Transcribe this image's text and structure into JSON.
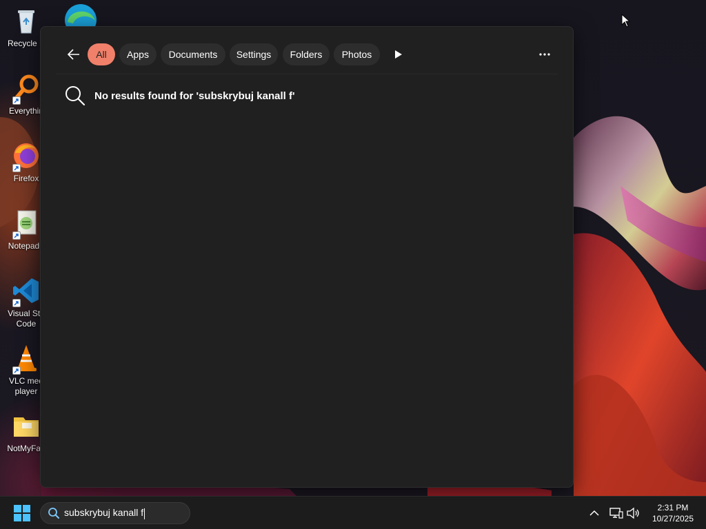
{
  "desktop": {
    "icons": [
      {
        "label": "Recycle B",
        "icon": "recycle-bin-icon"
      },
      {
        "label": "Everythin",
        "icon": "everything-search-icon"
      },
      {
        "label": "Firefox",
        "icon": "firefox-icon"
      },
      {
        "label": "Notepad+",
        "icon": "notepad-plus-plus-icon"
      },
      {
        "label": "Visual Stu Code",
        "line1": "Visual Stu",
        "line2": "Code",
        "icon": "vscode-icon"
      },
      {
        "label": "VLC med player",
        "line1": "VLC med",
        "line2": "player",
        "icon": "vlc-icon"
      },
      {
        "label": "NotMyFau",
        "icon": "folder-icon"
      }
    ],
    "partial_icon": "edge-icon"
  },
  "search_panel": {
    "back_icon": "back-arrow-icon",
    "filters": [
      {
        "label": "All",
        "active": true
      },
      {
        "label": "Apps",
        "active": false
      },
      {
        "label": "Documents",
        "active": false
      },
      {
        "label": "Settings",
        "active": false
      },
      {
        "label": "Folders",
        "active": false
      },
      {
        "label": "Photos",
        "active": false
      }
    ],
    "play_icon": "play-icon",
    "more_icon": "more-options-icon",
    "no_results_message": "No results found for 'subskrybuj kanall f'"
  },
  "taskbar": {
    "start_icon": "windows-start-icon",
    "search_value": "subskrybuj kanall f",
    "tray": {
      "chevron_icon": "chevron-up-icon",
      "network_icon": "network-icon",
      "volume_icon": "volume-icon"
    },
    "time": "2:31 PM",
    "date": "10/27/2025"
  },
  "colors": {
    "accent_chip": "#f0806a",
    "panel_bg": "#202020",
    "taskbar_bg": "#1c1c1c"
  }
}
